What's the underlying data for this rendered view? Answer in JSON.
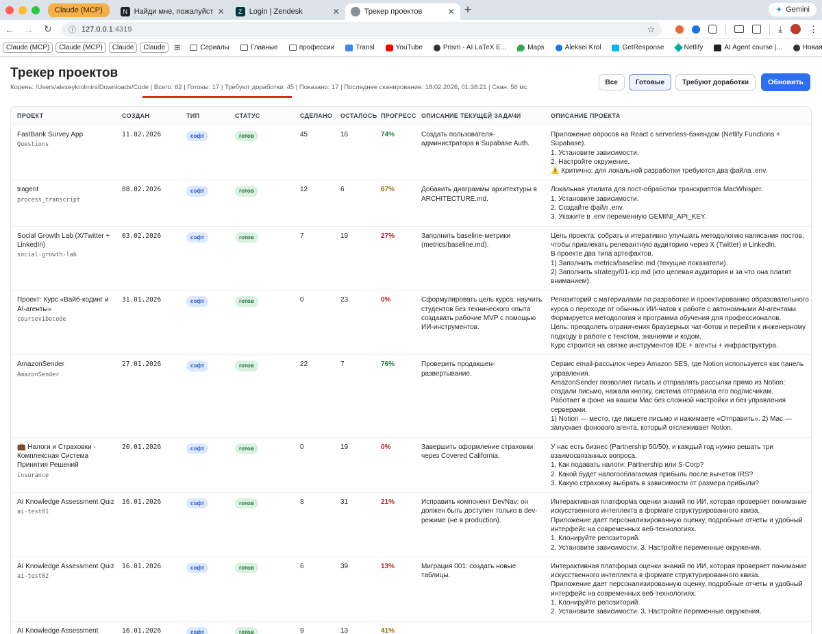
{
  "browser": {
    "tab_group": "Claude (MCP)",
    "tabs": [
      {
        "title": "Найди мне, пожалуйста, са",
        "favicon_color": "#222222"
      },
      {
        "title": "Login | Zendesk",
        "favicon_color": "#03363d"
      },
      {
        "title": "Трекер проектов",
        "favicon_color": "#8a8f96",
        "active": true
      }
    ],
    "new_tab": "+",
    "gemini": "Gemini",
    "url_host": "127.0.0.1",
    "url_port": ":4319",
    "bookmarks": [
      {
        "label": "Claude (MCP)",
        "kind": "chip"
      },
      {
        "label": "Claude (MCP)",
        "kind": "chip"
      },
      {
        "label": "Claude",
        "kind": "chip"
      },
      {
        "label": "Claude",
        "kind": "chip"
      },
      {
        "label": "Сериалы",
        "kind": "folder"
      },
      {
        "label": "Главные",
        "kind": "folder"
      },
      {
        "label": "профессии",
        "kind": "folder"
      },
      {
        "label": "Transl",
        "kind": "link",
        "color": "#4285f4"
      },
      {
        "label": "YouTube",
        "kind": "link",
        "color": "#ff0000"
      },
      {
        "label": "Prism - AI LaTeX E...",
        "kind": "link",
        "color": "#333333"
      },
      {
        "label": "Maps",
        "kind": "link",
        "color": "#34a853"
      },
      {
        "label": "Aleksei Krol",
        "kind": "link",
        "color": "#1877f2"
      },
      {
        "label": "GetResponse",
        "kind": "link",
        "color": "#00baff"
      },
      {
        "label": "Netlify",
        "kind": "link",
        "color": "#00ad9f"
      },
      {
        "label": "AI Agent course |...",
        "kind": "link",
        "color": "#222222"
      },
      {
        "label": "Новая вкладка",
        "kind": "link",
        "color": "#333333"
      }
    ]
  },
  "page": {
    "title": "Трекер проектов",
    "meta": "Корень: /Users/alexeykrolmini/Downloads/Code | Всего: 62 | Готовы: 17 | Требуют доработки: 45 | Показано: 17 | Последнее сканирование: 18.02.2026, 01:38:21 | Скан: 56 мс",
    "filters": {
      "all": "Все",
      "ready": "Готовые",
      "needs_work": "Требуют доработки"
    },
    "refresh": "Обновить"
  },
  "table": {
    "columns": [
      "ПРОЕКТ",
      "СОЗДАН",
      "ТИП",
      "СТАТУС",
      "СДЕЛАНО",
      "ОСТАЛОСЬ",
      "ПРОГРЕСС",
      "ОПИСАНИЕ ТЕКУЩЕЙ ЗАДАЧИ",
      "ОПИСАНИЕ ПРОЕКТА"
    ],
    "rows": [
      {
        "name": "FastBank Survey App",
        "code": "Questions",
        "created": "11.02.2026",
        "type": "софт",
        "status": "готов",
        "done": "45",
        "left": "16",
        "progress": "74%",
        "progress_color": "#1a7f37",
        "task": "Создать пользователя-администратора в Supabase Auth.",
        "desc": "Приложение опросов на React с serverless-бэкендом (Netlify Functions + Supabase).\n1. Установите зависимости.\n2. Настройте окружение.\n⚠️ Критично: для локальной разработки требуются два файла .env."
      },
      {
        "name": "tragent",
        "code": "process_transcript",
        "created": "08.02.2026",
        "type": "софт",
        "status": "готов",
        "done": "12",
        "left": "6",
        "progress": "67%",
        "progress_color": "#9a6700",
        "task": "Добавить диаграммы архитектуры в ARCHITECTURE.md.",
        "desc": "Локальная утилита для пост-обработки транскриптов MacWhisper.\n1. Установите зависимости.\n2. Создайте файл .env.\n3. Укажите в .env переменную GEMINI_API_KEY."
      },
      {
        "name": "Social Growth Lab (X/Twitter + LinkedIn)",
        "code": "social-growth-lab",
        "created": "03.02.2026",
        "type": "софт",
        "status": "готов",
        "done": "7",
        "left": "19",
        "progress": "27%",
        "progress_color": "#b42318",
        "task": "Заполнить baseline-метрики (metrics/baseline.md).",
        "desc": "Цель проекта: собрать и итеративно улучшать методологию написания постов, чтобы привлекать релевантную аудиторию через X (Twitter) и LinkedIn.\nВ проекте два типа артефактов.\n1) Заполнить metrics/baseline.md (текущие показатели).\n2) Заполнить strategy/01-icp.md (кто целевая аудитория и за что она платит вниманием)."
      },
      {
        "name": "Проект: Курс «Вайб-кодинг и AI-агенты»",
        "code": "coursevibecode",
        "created": "31.01.2026",
        "type": "софт",
        "status": "готов",
        "done": "0",
        "left": "23",
        "progress": "0%",
        "progress_color": "#b42318",
        "task": "Сформулировать цель курса: научить студентов без технического опыта создавать рабочие MVP с помощью ИИ-инструментов.",
        "desc": "Репозиторий с материалами по разработке и проектированию образовательного курса о переходе от обычных ИИ-чатов к работе с автономными AI-агентами.\nФормируется методология и программа обучения для профессионалов.\nЦель: преодолеть ограничения браузерных чат-ботов и перейти к инженерному подходу в работе с текстом, знаниями и кодом.\nКурс строится на связке инструментов IDE + агенты + инфраструктура."
      },
      {
        "name": "AmazonSender",
        "code": "AmazonSender",
        "created": "27.01.2026",
        "type": "софт",
        "status": "готов",
        "done": "22",
        "left": "7",
        "progress": "76%",
        "progress_color": "#1a7f37",
        "task": "Проверить продакшен-развертывание.",
        "desc": "Сервис email-рассылок через Amazon SES, где Notion используется как панель управления.\nAmazonSender позволяет писать и отправлять рассылки прямо из Notion: создали письмо, нажали кнопку, система отправила его подписчикам.\nРаботает в фоне на вашем Mac без сложной настройки и без управления серверами.\n1) Notion — место, где пишете письмо и нажимаете «Отправить». 2) Mac — запускает фонового агента, который отслеживает Notion."
      },
      {
        "name": "💼 Налоги и Страховки - Комплексная Система Принятия Решений",
        "code": "insurance",
        "created": "20.01.2026",
        "type": "софт",
        "status": "готов",
        "done": "0",
        "left": "19",
        "progress": "0%",
        "progress_color": "#b42318",
        "task": "Завершить оформление страховки через Covered California.",
        "desc": "У нас есть бизнес (Partnership 50/50), и каждый год нужно решать три взаимосвязанных вопроса.\n1. Как подавать налоги: Partnership или S-Corp?\n2. Какой будет налогооблагаемая прибыль после вычетов IRS?\n3. Какую страховку выбрать в зависимости от размера прибыли?"
      },
      {
        "name": "AI Knowledge Assessment Quiz",
        "code": "ai-test01",
        "created": "16.01.2026",
        "type": "софт",
        "status": "готов",
        "done": "8",
        "left": "31",
        "progress": "21%",
        "progress_color": "#b42318",
        "task": "Исправить компонент DevNav: он должен быть доступен только в dev-режиме (не в production).",
        "desc": "Интерактивная платформа оценки знаний по ИИ, которая проверяет понимание искусственного интеллекта в формате структурированного квиза.\nПриложение дает персонализированную оценку, подробные отчеты и удобный интерфейс на современных веб-технологиях.\n1. Клонируйте репозиторий.\n2. Установите зависимости. 3. Настройте переменные окружения."
      },
      {
        "name": "AI Knowledge Assessment Quiz",
        "code": "ai-test02",
        "created": "16.01.2026",
        "type": "софт",
        "status": "готов",
        "done": "6",
        "left": "39",
        "progress": "13%",
        "progress_color": "#b42318",
        "task": "Миграция 001: создать новые таблицы.",
        "desc": "Интерактивная платформа оценки знаний по ИИ, которая проверяет понимание искусственного интеллекта в формате структурированного квиза.\nПриложение дает персонализированную оценку, подробные отчеты и удобный интерфейс на современных веб-технологиях.\n1. Клонируйте репозиторий.\n2. Установите зависимости. 3. Настройте переменные окружения."
      },
      {
        "name": "AI Knowledge Assessment",
        "code": "",
        "created": "16.01.2026",
        "type": "софт",
        "status": "готов",
        "done": "9",
        "left": "13",
        "progress": "41%",
        "progress_color": "#9a6700",
        "task": "",
        "desc": ""
      }
    ]
  }
}
